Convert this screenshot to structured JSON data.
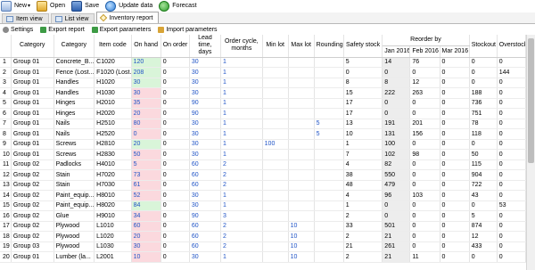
{
  "toolbar": {
    "new": "New",
    "open": "Open",
    "save": "Save",
    "update": "Update data",
    "forecast": "Forecast"
  },
  "tabs": [
    {
      "label": "Item view"
    },
    {
      "label": "List view"
    },
    {
      "label": "Inventory report"
    }
  ],
  "actions": {
    "settings": "Settings",
    "export_report": "Export report",
    "export_params": "Export parameters",
    "import_params": "Import parameters"
  },
  "table": {
    "headers": {
      "category1": "Category",
      "category2": "Category",
      "item_code": "Item code",
      "on_hand": "On hand",
      "on_order": "On order",
      "lead_time": "Lead time, days",
      "order_cycle": "Order cycle, months",
      "min_lot": "Min lot",
      "max_lot": "Max lot",
      "rounding": "Rounding",
      "safety_stock": "Safety stock",
      "reorder_by": "Reorder by",
      "jan": "Jan 2016",
      "feb": "Feb 2016",
      "mar": "Mar 2016",
      "stockout": "Stockout",
      "overstock": "Overstock"
    },
    "rows": [
      {
        "n": "1",
        "c1": "Group 01",
        "c2": "Concrete_B...",
        "code": "C1020",
        "onhand": "120",
        "onorder": "0",
        "lead": "30",
        "cycle": "1",
        "min": "",
        "max": "",
        "round": "",
        "safety": "5",
        "jan": "14",
        "feb": "76",
        "mar": "0",
        "stockout": "0",
        "overstock": "0"
      },
      {
        "n": "2",
        "c1": "Group 01",
        "c2": "Fence (Lost...",
        "code": "F1020 (Lost...",
        "onhand": "208",
        "onorder": "0",
        "lead": "30",
        "cycle": "1",
        "min": "",
        "max": "",
        "round": "",
        "safety": "0",
        "jan": "0",
        "feb": "0",
        "mar": "0",
        "stockout": "0",
        "overstock": "144"
      },
      {
        "n": "3",
        "c1": "Group 01",
        "c2": "Handles",
        "code": "H1020",
        "onhand": "30",
        "onorder": "0",
        "lead": "30",
        "cycle": "1",
        "min": "",
        "max": "",
        "round": "",
        "safety": "8",
        "jan": "8",
        "feb": "12",
        "mar": "0",
        "stockout": "0",
        "overstock": "0"
      },
      {
        "n": "4",
        "c1": "Group 01",
        "c2": "Handles",
        "code": "H1030",
        "onhand": "30",
        "onorder": "0",
        "lead": "30",
        "cycle": "1",
        "min": "",
        "max": "",
        "round": "",
        "safety": "15",
        "jan": "222",
        "feb": "263",
        "mar": "0",
        "stockout": "188",
        "overstock": "0"
      },
      {
        "n": "5",
        "c1": "Group 01",
        "c2": "Hinges",
        "code": "H2010",
        "onhand": "35",
        "onorder": "0",
        "lead": "90",
        "cycle": "1",
        "min": "",
        "max": "",
        "round": "",
        "safety": "17",
        "jan": "0",
        "feb": "0",
        "mar": "0",
        "stockout": "736",
        "overstock": "0"
      },
      {
        "n": "6",
        "c1": "Group 01",
        "c2": "Hinges",
        "code": "H2020",
        "onhand": "20",
        "onorder": "0",
        "lead": "90",
        "cycle": "1",
        "min": "",
        "max": "",
        "round": "",
        "safety": "17",
        "jan": "0",
        "feb": "0",
        "mar": "0",
        "stockout": "751",
        "overstock": "0"
      },
      {
        "n": "7",
        "c1": "Group 01",
        "c2": "Nails",
        "code": "H2510",
        "onhand": "80",
        "onorder": "0",
        "lead": "30",
        "cycle": "1",
        "min": "",
        "max": "",
        "round": "5",
        "safety": "13",
        "jan": "191",
        "feb": "201",
        "mar": "0",
        "stockout": "78",
        "overstock": "0"
      },
      {
        "n": "8",
        "c1": "Group 01",
        "c2": "Nails",
        "code": "H2520",
        "onhand": "0",
        "onorder": "0",
        "lead": "30",
        "cycle": "1",
        "min": "",
        "max": "",
        "round": "5",
        "safety": "10",
        "jan": "131",
        "feb": "156",
        "mar": "0",
        "stockout": "118",
        "overstock": "0"
      },
      {
        "n": "9",
        "c1": "Group 01",
        "c2": "Screws",
        "code": "H2810",
        "onhand": "20",
        "onorder": "0",
        "lead": "30",
        "cycle": "1",
        "min": "100",
        "max": "",
        "round": "",
        "safety": "1",
        "jan": "100",
        "feb": "0",
        "mar": "0",
        "stockout": "0",
        "overstock": "0"
      },
      {
        "n": "10",
        "c1": "Group 01",
        "c2": "Screws",
        "code": "H2830",
        "onhand": "50",
        "onorder": "0",
        "lead": "30",
        "cycle": "1",
        "min": "",
        "max": "",
        "round": "",
        "safety": "7",
        "jan": "102",
        "feb": "98",
        "mar": "0",
        "stockout": "50",
        "overstock": "0"
      },
      {
        "n": "11",
        "c1": "Group 02",
        "c2": "Padlocks",
        "code": "H4010",
        "onhand": "5",
        "onorder": "0",
        "lead": "60",
        "cycle": "2",
        "min": "",
        "max": "",
        "round": "",
        "safety": "4",
        "jan": "82",
        "feb": "0",
        "mar": "0",
        "stockout": "115",
        "overstock": "0"
      },
      {
        "n": "12",
        "c1": "Group 02",
        "c2": "Stain",
        "code": "H7020",
        "onhand": "73",
        "onorder": "0",
        "lead": "60",
        "cycle": "2",
        "min": "",
        "max": "",
        "round": "",
        "safety": "38",
        "jan": "550",
        "feb": "0",
        "mar": "0",
        "stockout": "904",
        "overstock": "0"
      },
      {
        "n": "13",
        "c1": "Group 02",
        "c2": "Stain",
        "code": "H7030",
        "onhand": "61",
        "onorder": "0",
        "lead": "60",
        "cycle": "2",
        "min": "",
        "max": "",
        "round": "",
        "safety": "48",
        "jan": "479",
        "feb": "0",
        "mar": "0",
        "stockout": "722",
        "overstock": "0"
      },
      {
        "n": "14",
        "c1": "Group 02",
        "c2": "Paint_equip...",
        "code": "H8010",
        "onhand": "52",
        "onorder": "0",
        "lead": "30",
        "cycle": "1",
        "min": "",
        "max": "",
        "round": "",
        "safety": "4",
        "jan": "96",
        "feb": "103",
        "mar": "0",
        "stockout": "43",
        "overstock": "0"
      },
      {
        "n": "15",
        "c1": "Group 02",
        "c2": "Paint_equip...",
        "code": "H8020",
        "onhand": "84",
        "onorder": "0",
        "lead": "30",
        "cycle": "1",
        "min": "",
        "max": "",
        "round": "",
        "safety": "1",
        "jan": "0",
        "feb": "0",
        "mar": "0",
        "stockout": "0",
        "overstock": "53"
      },
      {
        "n": "16",
        "c1": "Group 02",
        "c2": "Glue",
        "code": "H9010",
        "onhand": "34",
        "onorder": "0",
        "lead": "90",
        "cycle": "3",
        "min": "",
        "max": "",
        "round": "",
        "safety": "2",
        "jan": "0",
        "feb": "0",
        "mar": "0",
        "stockout": "5",
        "overstock": "0"
      },
      {
        "n": "17",
        "c1": "Group 02",
        "c2": "Plywood",
        "code": "L1010",
        "onhand": "60",
        "onorder": "0",
        "lead": "60",
        "cycle": "2",
        "min": "",
        "max": "10",
        "round": "",
        "safety": "33",
        "jan": "501",
        "feb": "0",
        "mar": "0",
        "stockout": "874",
        "overstock": "0"
      },
      {
        "n": "18",
        "c1": "Group 02",
        "c2": "Plywood",
        "code": "L1020",
        "onhand": "20",
        "onorder": "0",
        "lead": "60",
        "cycle": "2",
        "min": "",
        "max": "10",
        "round": "",
        "safety": "2",
        "jan": "21",
        "feb": "0",
        "mar": "0",
        "stockout": "12",
        "overstock": "0"
      },
      {
        "n": "19",
        "c1": "Group 03",
        "c2": "Plywood",
        "code": "L1030",
        "onhand": "30",
        "onorder": "0",
        "lead": "60",
        "cycle": "2",
        "min": "",
        "max": "10",
        "round": "",
        "safety": "21",
        "jan": "261",
        "feb": "0",
        "mar": "0",
        "stockout": "433",
        "overstock": "0"
      },
      {
        "n": "20",
        "c1": "Group 01",
        "c2": "Lumber (la...",
        "code": "L2001",
        "onhand": "10",
        "onorder": "0",
        "lead": "30",
        "cycle": "1",
        "min": "",
        "max": "10",
        "round": "",
        "safety": "2",
        "jan": "21",
        "feb": "11",
        "mar": "0",
        "stockout": "0",
        "overstock": "0"
      }
    ],
    "onhand_status": [
      "green",
      "green",
      "green",
      "pink",
      "pink",
      "pink",
      "pink",
      "pink",
      "green",
      "pink",
      "pink",
      "pink",
      "pink",
      "pink",
      "green",
      "pink",
      "pink",
      "pink",
      "pink",
      "pink"
    ]
  }
}
